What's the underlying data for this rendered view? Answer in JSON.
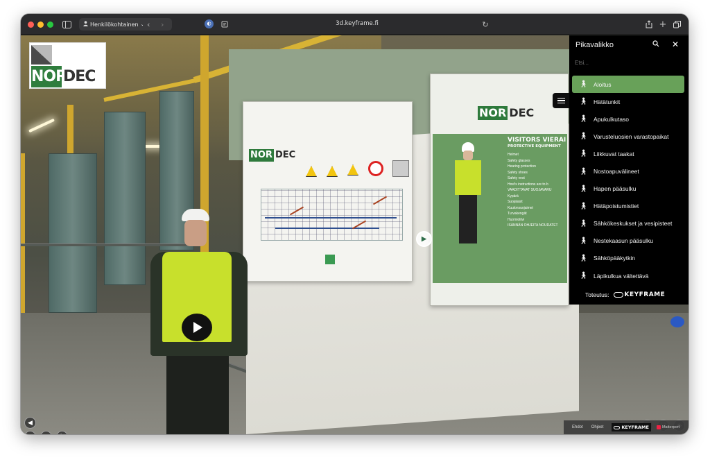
{
  "browser": {
    "profile_label": "Henkilökohtainen",
    "url": "3d.keyframe.fi"
  },
  "brand": {
    "logo_nor": "NOR",
    "logo_dec": "DEC"
  },
  "posters": {
    "visitors_heading": "VISITORS VIERAI",
    "protective_heading": "PROTECTIVE EQUIPMENT",
    "lines": [
      "Helmet",
      "Safety glasses",
      "Hearing protection",
      "Safety shoes",
      "Safety vest",
      "Host's instructions are to b",
      "VAADITTAVAT SUOJAVARU",
      "Kypärä",
      "Suojalasit",
      "Kuulonsuojaimet",
      "Turvakengät",
      "Huomioliivi",
      "ISÄNNÄN OHJEITA NOUDATET"
    ]
  },
  "menu": {
    "title": "Pikavalikko",
    "search_placeholder": "Etsi...",
    "items": [
      {
        "label": "Aloitus",
        "active": true
      },
      {
        "label": "Hätätunkit",
        "active": false
      },
      {
        "label": "Apukulkutaso",
        "active": false
      },
      {
        "label": "Varusteluosien varastopaikat",
        "active": false
      },
      {
        "label": "Liikkuvat taakat",
        "active": false
      },
      {
        "label": "Nostoapuvälineet",
        "active": false
      },
      {
        "label": "Hapen pääsulku",
        "active": false
      },
      {
        "label": "Hätäpoistumistiet",
        "active": false
      },
      {
        "label": "Sähkökeskukset ja vesipisteet",
        "active": false
      },
      {
        "label": "Nestekaasun pääsulku",
        "active": false
      },
      {
        "label": "Sähköpääkytkin",
        "active": false
      },
      {
        "label": "Läpikulkua vältettävä",
        "active": false
      }
    ],
    "footer_label": "Toteutus:",
    "footer_brand": "KEYFRAME"
  },
  "bottom_bar": {
    "item1": "Ehdot",
    "item2": "Ohjeet",
    "brand": "KEYFRAME",
    "provider": "Matterport"
  },
  "colors": {
    "accent_green": "#68a159",
    "nordec_green": "#2f7d3d",
    "menu_bg": "#000000"
  },
  "icons": {
    "volume": "volume-icon",
    "play": "play-icon",
    "share": "share-icon",
    "fullscreen": "fullscreen-icon",
    "view_3d": "cube-icon"
  }
}
